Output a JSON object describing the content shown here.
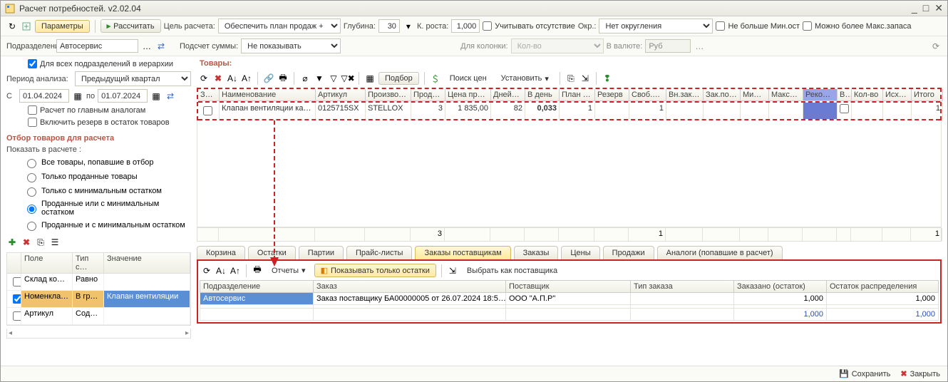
{
  "window": {
    "title": "Расчет потребностей. v2.02.04"
  },
  "toolbar1": {
    "params_btn": "Параметры",
    "calc_btn": "Рассчитать",
    "goal_lbl": "Цель расчета:",
    "goal_val": "Обеспечить план продаж + мин",
    "depth_lbl": "Глубина:",
    "depth_val": "30",
    "growth_lbl": "К. роста:",
    "growth_val": "1,000",
    "absence_chk": "Учитывать отсутствие",
    "round_lbl": "Окр.:",
    "round_val": "Нет округления",
    "minstock_chk": "Не больше Мин.ост",
    "maxstock_chk": "Можно более Макс.запаса"
  },
  "left": {
    "subdiv_lbl": "Подразделение:",
    "subdiv_val": "Автосервис",
    "all_subdiv_chk": "Для всех подразделений в иерархии",
    "period_lbl": "Период анализа:",
    "period_val": "Предыдущий квартал",
    "date_from_lbl": "С",
    "date_from": "01.04.2024",
    "date_to_lbl": "по",
    "date_to": "01.07.2024",
    "main_analogs_chk": "Расчет по главным аналогам",
    "reserve_chk": "Включить резерв в остаток товаров",
    "filter_heading": "Отбор товаров для расчета",
    "show_lbl": "Показать в расчете :",
    "radios": {
      "r1": "Все товары, попавшие в отбор",
      "r2": "Только проданные товары",
      "r3": "Только с минимальным остатком",
      "r4": "Проданные или с минимальным остатком",
      "r5": "Проданные и с минимальным остатком"
    },
    "filter_cols": {
      "c1": "Поле",
      "c2": "Тип с…",
      "c3": "Значение"
    },
    "filter_rows": [
      {
        "chk": false,
        "f": "Склад комп…",
        "t": "Равно",
        "v": ""
      },
      {
        "chk": true,
        "f": "Номенклат…",
        "t": "В гру…",
        "v": "Клапан вентиляции"
      },
      {
        "chk": false,
        "f": "Артикул",
        "t": "Соде…",
        "v": ""
      }
    ]
  },
  "toolbar2": {
    "sum_lbl": "Подсчет суммы:",
    "sum_val": "Не показывать",
    "col_lbl": "Для колонки:",
    "col_val": "Кол-во",
    "cur_lbl": "В валюте:",
    "cur_val": "Руб"
  },
  "products_lbl": "Товары:",
  "grid_tb": {
    "podbor": "Подбор",
    "poisk": "Поиск цен",
    "ustanovit": "Установить"
  },
  "grid": {
    "cols": [
      "За…",
      "Наименование",
      "Артикул",
      "Производ…",
      "Прода…",
      "Цена про…",
      "Дней…",
      "В день",
      "План п…",
      "Резерв",
      "Своб.о…",
      "Вн.зак…",
      "Зак.по…",
      "Ми…",
      "Макс…",
      "Реком…",
      "В…",
      "Кол-во",
      "Исхо…",
      "Итого"
    ],
    "row": {
      "name": "Клапан вентиляции кар…",
      "art": "0125715SX",
      "prod": "STELLOX",
      "sold": "3",
      "price": "1 835,00",
      "days": "82",
      "perday": "0,033",
      "plan": "1",
      "reserve": "",
      "free": "1",
      "inorder": "",
      "po": "",
      "min": "",
      "max": "",
      "rec": "",
      "v": "",
      "qty": "",
      "src": "",
      "total": "1"
    },
    "summary": {
      "sold": "3",
      "free": "1",
      "total": "1"
    }
  },
  "tabs": [
    "Корзина",
    "Остатки",
    "Партии",
    "Прайс-листы",
    "Заказы поставщикам",
    "Заказы",
    "Цены",
    "Продажи",
    "Аналоги (попавшие в расчет)"
  ],
  "lower_tb": {
    "reports": "Отчеты",
    "only_rest": "Показывать только остатки",
    "choose_sup": "Выбрать как поставщика"
  },
  "lower": {
    "cols": [
      "Подразделение",
      "Заказ",
      "Поставщик",
      "Тип заказа",
      "Заказано (остаток)",
      "Остаток распределения"
    ],
    "row": {
      "subdiv": "Автосервис",
      "order": "Заказ поставщику БА00000005 от 26.07.2024 18:5…",
      "supplier": "ООО \"А.П.Р\"",
      "type": "",
      "ordered": "1,000",
      "rest": "1,000"
    },
    "total": {
      "ordered": "1,000",
      "rest": "1,000"
    }
  },
  "status": {
    "save": "Сохранить",
    "close": "Закрыть"
  }
}
